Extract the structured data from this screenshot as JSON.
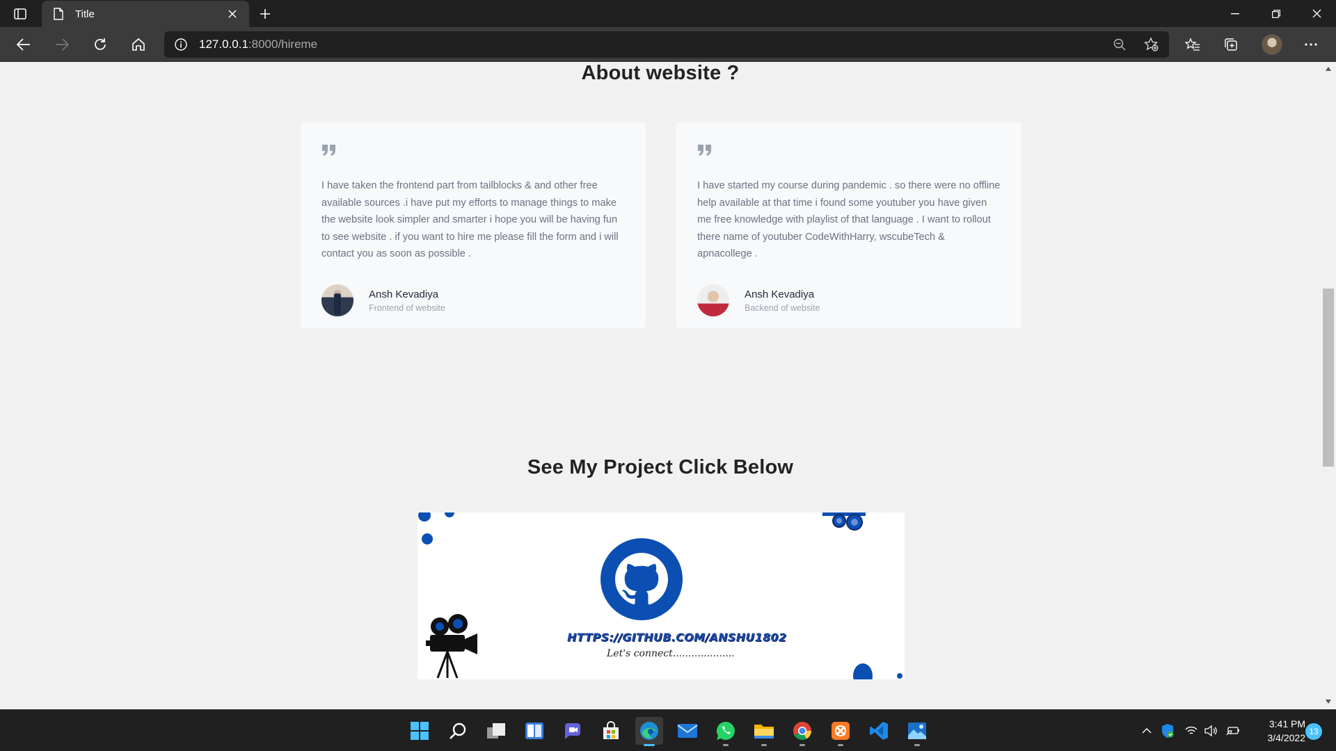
{
  "browser": {
    "tab_title": "Title",
    "url_host": "127.0.0.1",
    "url_path": ":8000/hireme"
  },
  "page": {
    "about_title": "About website ?",
    "cards": [
      {
        "text": "I have taken the frontend part from tailblocks & and other free available sources .i have put my efforts to manage things to make the website look simpler and smarter i hope you will be having fun to see website . if you want to hire me please fill the form and i will contact you as soon as possible .",
        "author": "Ansh Kevadiya",
        "role": "Frontend of website"
      },
      {
        "text": "I have started my course during pandemic . so there were no offline help available at that time i found some youtuber you have given me free knowledge with playlist of that language . I want to rollout there name of youtuber CodeWithHarry, wscubeTech & apnacollege .",
        "author": "Ansh Kevadiya",
        "role": "Backend of website"
      }
    ],
    "project_title": "See My Project Click Below",
    "banner": {
      "github_url": "HTTPS://GITHUB.COM/ANSHU1802",
      "tagline": "Let's connect...................."
    }
  },
  "taskbar": {
    "time": "3:41 PM",
    "date": "3/4/2022",
    "notification_count": "13",
    "apps": [
      "start",
      "search",
      "task-view",
      "widgets",
      "teams-chat",
      "store",
      "edge",
      "mail",
      "whatsapp",
      "file-explorer",
      "chrome",
      "xampp",
      "vscode",
      "photos"
    ]
  },
  "colors": {
    "accent_blue": "#0b4fb3",
    "taskbar_active": "#4cc2ff",
    "chrome_dark": "#202020"
  }
}
